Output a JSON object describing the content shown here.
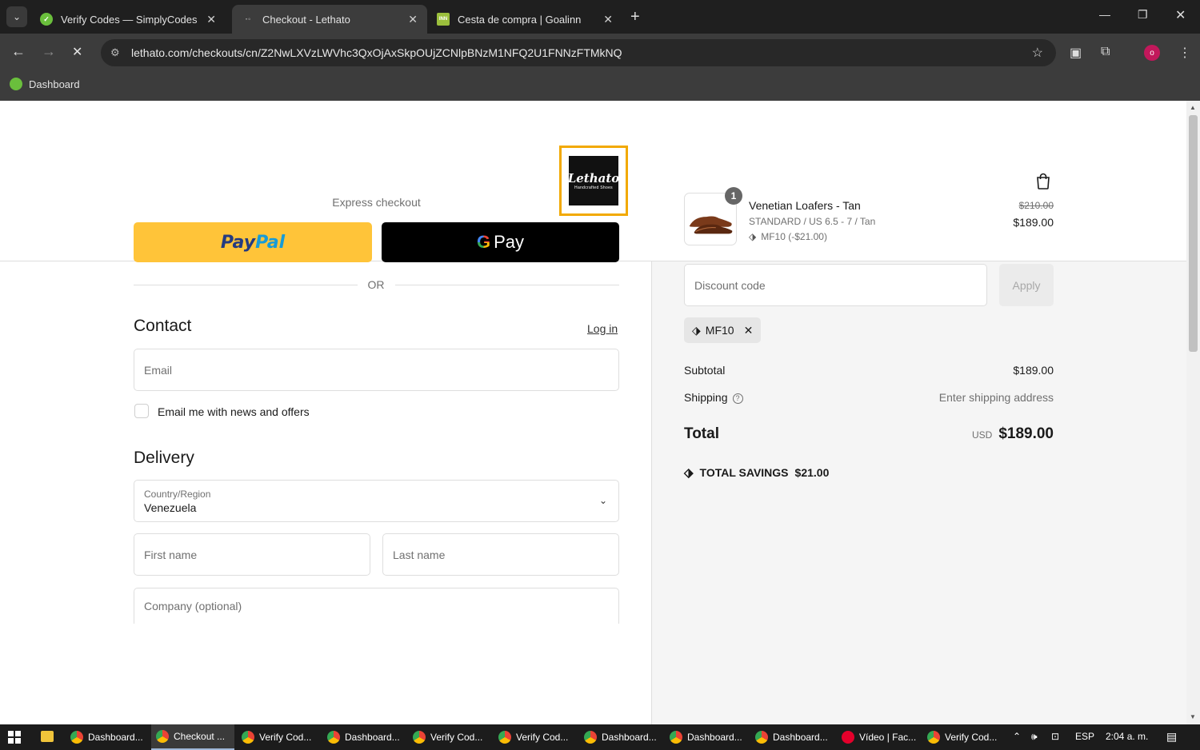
{
  "browser": {
    "tabs": [
      {
        "title": "Verify Codes — SimplyCodes",
        "favicon": "simplycodes-icon"
      },
      {
        "title": "Checkout - Lethato",
        "favicon": "loading-icon"
      },
      {
        "title": "Cesta de compra | Goalinn",
        "favicon": "goalinn-icon"
      }
    ],
    "url": "lethato.com/checkouts/cn/Z2NwLXVzLWVhc3QxOjAxSkpOUjZCNlpBNzM1NFQ2U1FNNzFTMkNQ",
    "bookmark": "Dashboard",
    "profile_initial": "o"
  },
  "store": {
    "logo_word": "Lethato",
    "logo_sub": "Handcrafted Shoes"
  },
  "checkout": {
    "express_label": "Express checkout",
    "paypal_a": "Pay",
    "paypal_b": "Pal",
    "gpay_g": "G",
    "gpay_label": "Pay",
    "or_label": "OR",
    "contact_heading": "Contact",
    "login_link": "Log in",
    "email_placeholder": "Email",
    "newsletter_label": "Email me with news and offers",
    "delivery_heading": "Delivery",
    "country_label": "Country/Region",
    "country_value": "Venezuela",
    "first_name_placeholder": "First name",
    "last_name_placeholder": "Last name",
    "company_placeholder": "Company (optional)"
  },
  "summary": {
    "item": {
      "quantity": "1",
      "name": "Venetian Loafers - Tan",
      "variant": "STANDARD / US 6.5 - 7 / Tan",
      "discount": "MF10 (-$21.00)",
      "original_price": "$210.00",
      "price": "$189.00"
    },
    "discount_placeholder": "Discount code",
    "apply_label": "Apply",
    "applied_code": "MF10",
    "subtotal_label": "Subtotal",
    "subtotal_value": "$189.00",
    "shipping_label": "Shipping",
    "shipping_value": "Enter shipping address",
    "total_label": "Total",
    "currency": "USD",
    "total_value": "$189.00",
    "savings_label": "TOTAL SAVINGS",
    "savings_value": "$21.00"
  },
  "taskbar": {
    "items": [
      {
        "label": "Dashboard...",
        "icon": "chrome-icon"
      },
      {
        "label": "Checkout ...",
        "icon": "chrome-icon"
      },
      {
        "label": "Verify Cod...",
        "icon": "chrome-icon"
      },
      {
        "label": "Dashboard...",
        "icon": "chrome-icon"
      },
      {
        "label": "Verify Cod...",
        "icon": "chrome-icon"
      },
      {
        "label": "Verify Cod...",
        "icon": "chrome-icon"
      },
      {
        "label": "Dashboard...",
        "icon": "chrome-icon"
      },
      {
        "label": "Dashboard...",
        "icon": "chrome-icon"
      },
      {
        "label": "Dashboard...",
        "icon": "chrome-icon"
      },
      {
        "label": "Vídeo | Fac...",
        "icon": "opera-icon"
      },
      {
        "label": "Verify Cod...",
        "icon": "chrome-icon"
      }
    ],
    "language": "ESP",
    "time": "2:04 a. m."
  },
  "colors": {
    "paypal_yellow": "#ffc439",
    "logo_border": "#f2a900",
    "panel_bg": "#f5f5f5"
  }
}
